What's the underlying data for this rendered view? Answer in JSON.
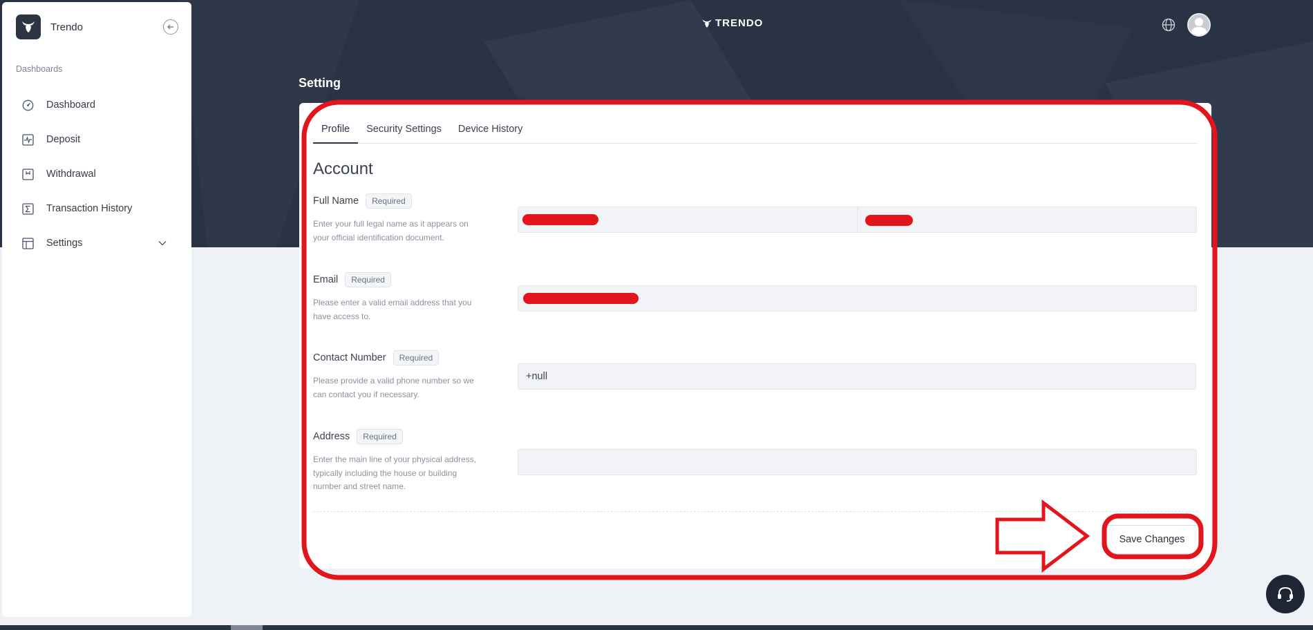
{
  "sidebar": {
    "brand": "Trendo",
    "section": "Dashboards",
    "items": [
      {
        "label": "Dashboard",
        "icon": "gauge-icon"
      },
      {
        "label": "Deposit",
        "icon": "activity-icon"
      },
      {
        "label": "Withdrawal",
        "icon": "receipt-icon"
      },
      {
        "label": "Transaction History",
        "icon": "sigma-icon"
      },
      {
        "label": "Settings",
        "icon": "table-icon"
      }
    ]
  },
  "header": {
    "logo_text": "TRENDO"
  },
  "page": {
    "title": "Setting"
  },
  "tabs": [
    {
      "label": "Profile",
      "active": true
    },
    {
      "label": "Security Settings",
      "active": false
    },
    {
      "label": "Device History",
      "active": false
    }
  ],
  "form": {
    "title": "Account",
    "required_badge": "Required",
    "full_name": {
      "label": "Full Name",
      "help": "Enter your full legal name as it appears on your official identification document."
    },
    "email": {
      "label": "Email",
      "help": "Please enter a valid email address that you have access to."
    },
    "contact": {
      "label": "Contact Number",
      "help": "Please provide a valid phone number so we can contact you if necessary.",
      "value": "+null"
    },
    "address": {
      "label": "Address",
      "help": "Enter the main line of your physical address, typically including the house or building number and street name.",
      "value": ""
    },
    "save_label": "Save Changes"
  },
  "colors": {
    "hero": "#2a3344",
    "annotation_red": "#e3151c",
    "accent_dark": "#2d3444"
  }
}
